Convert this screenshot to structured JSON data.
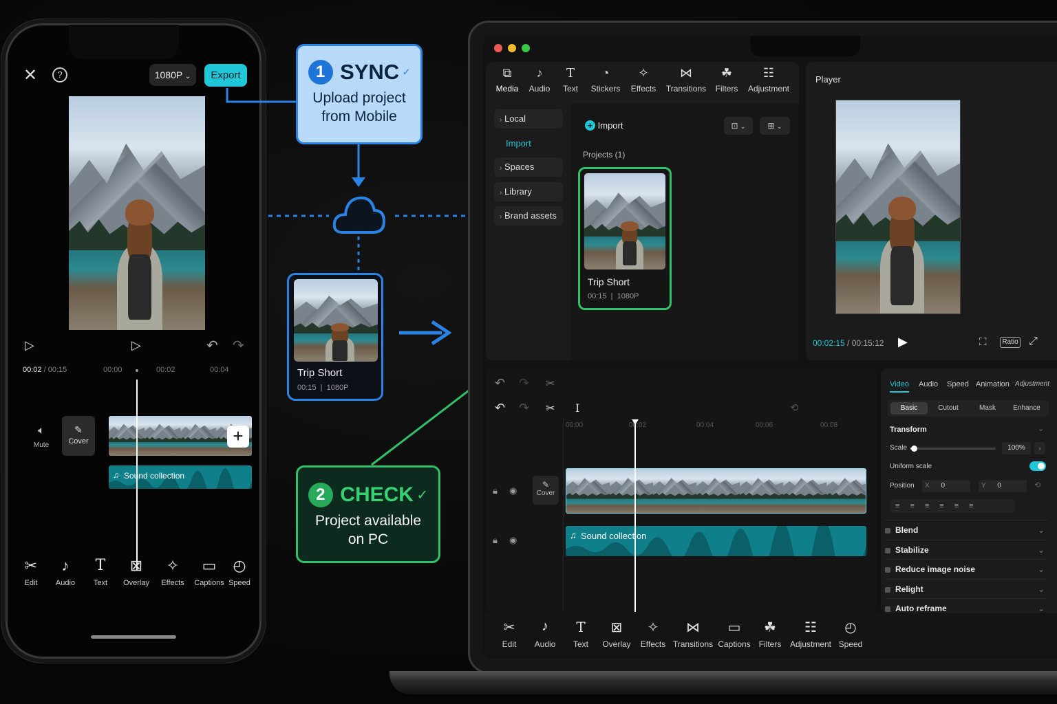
{
  "phone": {
    "resolution_label": "1080P",
    "export_label": "Export",
    "time_current": "00:02",
    "time_sep": " / ",
    "time_total": "00:15",
    "ruler": [
      "00:00",
      "00:02",
      "00:04"
    ],
    "mute_label": "Mute",
    "cover_label": "Cover",
    "audio_track_label": "Sound collection",
    "toolbar": [
      "Edit",
      "Audio",
      "Text",
      "Overlay",
      "Effects",
      "Captions",
      "Speed"
    ]
  },
  "sync": {
    "number": "1",
    "title": "SYNC",
    "line1": "Upload project",
    "line2": "from Mobile"
  },
  "check": {
    "number": "2",
    "title": "CHECK",
    "line1": "Project available",
    "line2": "on PC"
  },
  "mid_card": {
    "title": "Trip Short",
    "duration": "00:15",
    "resolution": "1080P"
  },
  "desktop": {
    "top_toolbar": [
      "Media",
      "Audio",
      "Text",
      "Stickers",
      "Effects",
      "Transitions",
      "Filters",
      "Adjustment"
    ],
    "sidebar": [
      "Local",
      "Import",
      "Spaces",
      "Library",
      "Brand assets"
    ],
    "import_label": "Import",
    "projects_label": "Projects (1)",
    "project_card": {
      "title": "Trip Short",
      "duration": "00:15",
      "resolution": "1080P"
    },
    "player": {
      "title": "Player",
      "time_current": "00:02:15",
      "time_sep": " / ",
      "time_total": "00:15:12",
      "ratio_label": "Ratio"
    },
    "timeline": {
      "ruler": [
        "00:00",
        "00:02",
        "00:04",
        "00:06",
        "00:08"
      ],
      "cover_label": "Cover",
      "audio_track_label": "Sound collection"
    },
    "properties": {
      "tabs": [
        "Video",
        "Audio",
        "Speed",
        "Animation",
        "Adjustment"
      ],
      "subtabs": [
        "Basic",
        "Cutout",
        "Mask",
        "Enhance"
      ],
      "transform_label": "Transform",
      "scale_label": "Scale",
      "scale_value": "100%",
      "scale_level": 0.04,
      "uniform_scale_label": "Uniform scale",
      "uniform_scale_on": true,
      "position_label": "Position",
      "pos_x_label": "X",
      "pos_x_value": "0",
      "pos_y_label": "Y",
      "pos_y_value": "0",
      "sections": [
        "Blend",
        "Stabilize",
        "Reduce image noise",
        "Relight",
        "Auto reframe"
      ]
    },
    "bottom_toolbar": [
      "Edit",
      "Audio",
      "Text",
      "Overlay",
      "Effects",
      "Transitions",
      "Captions",
      "Filters",
      "Adjustment",
      "Speed"
    ]
  },
  "colors": {
    "accent_cyan": "#1fc8d8",
    "sync_blue": "#2a84e6",
    "check_green": "#2fc26a",
    "audio_track": "#0f7f8a"
  }
}
